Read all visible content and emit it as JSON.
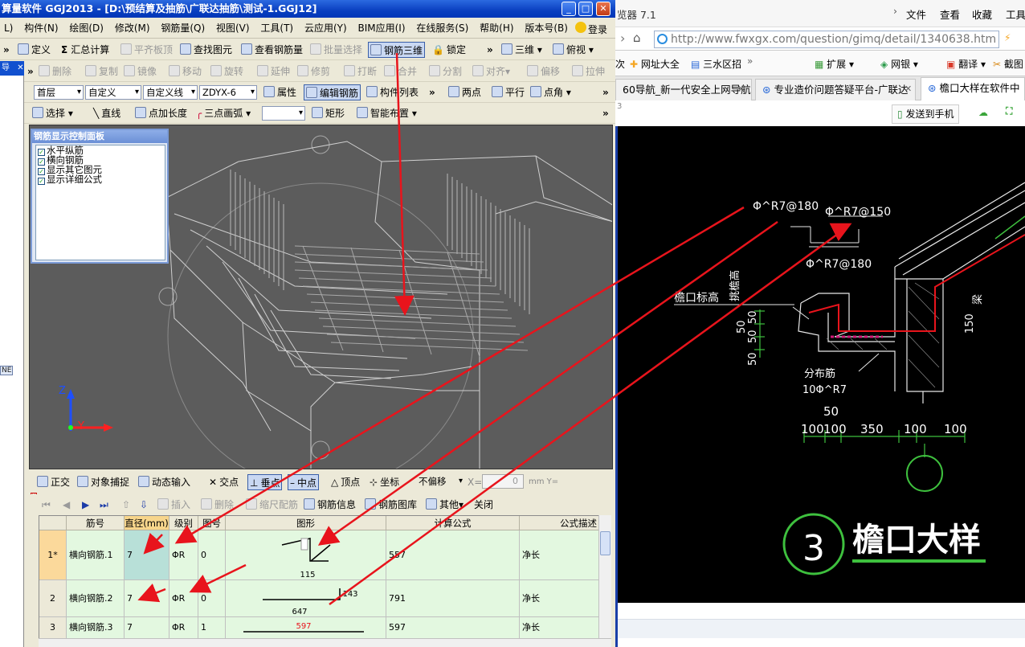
{
  "app": {
    "title": "算量软件 GGJ2013 - [D:\\预结算及抽筋\\广联达抽筋\\测试-1.GGJ12]",
    "login_label": "登录",
    "menus": [
      "L)",
      "构件(N)",
      "绘图(D)",
      "修改(M)",
      "钢筋量(Q)",
      "视图(V)",
      "工具(T)",
      "云应用(Y)",
      "BIM应用(I)",
      "在线服务(S)",
      "帮助(H)",
      "版本号(B)"
    ]
  },
  "toolbar1": {
    "define": "定义",
    "summary": "汇总计算",
    "align_slab": "平齐板顶",
    "find_element": "查找图元",
    "view_rebar_qty": "查看钢筋量",
    "batch_select": "批量选择",
    "rebar_3d": "钢筋三维",
    "lock": "锁定",
    "view3d": "三维",
    "top_view": "俯视"
  },
  "toolbar2": {
    "delete": "删除",
    "copy": "复制",
    "mirror": "镜像",
    "move": "移动",
    "rotate": "旋转",
    "extend": "延伸",
    "trim": "修剪",
    "break": "打断",
    "merge": "合并",
    "split": "分割",
    "align": "对齐",
    "offset": "偏移",
    "stretch": "拉伸"
  },
  "toolbar3": {
    "floor": "首层",
    "custom": "自定义",
    "custom_line": "自定义线",
    "component": "ZDYX-6",
    "property": "属性",
    "edit_rebar": "编辑钢筋",
    "component_list": "构件列表",
    "two_points": "两点",
    "parallel": "平行",
    "point_angle": "点角"
  },
  "toolbar4": {
    "select": "选择",
    "line": "直线",
    "point_length": "点加长度",
    "three_point_arc": "三点画弧",
    "rectangle": "矩形",
    "smart_layout": "智能布置"
  },
  "left_strip": {
    "title": "导",
    "ne_label": "NE"
  },
  "control_panel": {
    "title": "钢筋显示控制面板",
    "items": [
      "水平纵筋",
      "横向钢筋",
      "显示其它图元",
      "显示详细公式"
    ]
  },
  "axes": {
    "z": "Z",
    "y": "Y"
  },
  "status_bar": {
    "ortho": "正交",
    "snap": "对象捕捉",
    "dynamic_input": "动态输入",
    "intersection": "交点",
    "perpendicular": "垂点",
    "midpoint": "中点",
    "vertex": "顶点",
    "coordinate": "坐标",
    "no_offset": "不偏移",
    "x_label": "X=",
    "x_value": "0",
    "unit_label": "mm Y="
  },
  "grid_toolbar": {
    "insert": "插入",
    "delete": "删除",
    "scale_rebar": "缩尺配筋",
    "rebar_info": "钢筋信息",
    "rebar_library": "钢筋图库",
    "other": "其他",
    "close": "关闭"
  },
  "grid": {
    "headers": [
      "筋号",
      "直径(mm)",
      "级别",
      "图号",
      "图形",
      "计算公式",
      "公式描述"
    ],
    "rows": [
      {
        "index": "1*",
        "name": "横向钢筋.1",
        "diameter": "7",
        "grade": "ΦR",
        "fig_no": "0",
        "shape_labels": [
          "",
          "115"
        ],
        "formula": "557",
        "desc": "净长"
      },
      {
        "index": "2",
        "name": "横向钢筋.2",
        "diameter": "7",
        "grade": "ΦR",
        "fig_no": "0",
        "shape_labels": [
          "143",
          "647"
        ],
        "formula": "791",
        "desc": "净长"
      },
      {
        "index": "3",
        "name": "横向钢筋.3",
        "diameter": "7",
        "grade": "ΦR",
        "fig_no": "1",
        "shape_labels": [
          "597"
        ],
        "formula": "597",
        "desc": "净长"
      }
    ]
  },
  "browser": {
    "title": "览器 7.1",
    "menus": [
      "文件",
      "查看",
      "收藏",
      "工具"
    ],
    "url": "http://www.fwxgx.com/question/gimq/detail/1340638.htm",
    "favorites": [
      "次",
      "网址大全",
      "三水区招",
      "扩展",
      "网银",
      "翻译",
      "截图"
    ],
    "tabs": [
      "60导航_新一代安全上网导航",
      "专业造价问题答疑平台-广联达",
      "檐口大样在软件中"
    ],
    "send_to_phone": "发送到手机",
    "side_number": "3"
  },
  "cad": {
    "labels": [
      "Φ^R7@180",
      "Φ^R7@150",
      "Φ^R7@180",
      "檐口标高",
      "挑檐高",
      "50",
      "50",
      "50",
      "50",
      "分布筋",
      "10Φ^R7",
      "150",
      "梁",
      "50",
      "100",
      "100",
      "350",
      "100",
      "100"
    ],
    "detail_number": "3",
    "detail_title": "檐口大样"
  },
  "colors": {
    "accent_red": "#e8141c",
    "grid_row_bg": "#e3f8e0",
    "title_blue": "#0a3fc0",
    "cad_green": "#00c400"
  }
}
